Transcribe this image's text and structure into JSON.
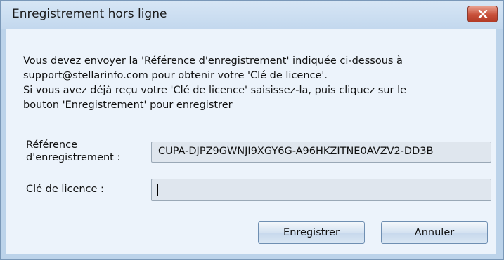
{
  "window": {
    "title": "Enregistrement hors ligne"
  },
  "message": {
    "lines": [
      "Vous devez envoyer la 'Référence d'enregistrement' indiquée ci-dessous à",
      "support@stellarinfo.com pour obtenir votre 'Clé de licence'.",
      "Si vous avez déjà reçu votre 'Clé de licence' saisissez-la, puis cliquez sur le",
      "bouton 'Enregistrement' pour enregistrer"
    ]
  },
  "form": {
    "reference_label_line1": "Référence",
    "reference_label_line2": "d'enregistrement :",
    "reference_value": "CUPA-DJPZ9GWNJI9XGY6G-A96HKZITNE0AVZV2-DD3B",
    "key_label": "Clé de licence :",
    "key_value": ""
  },
  "buttons": {
    "register_label": "Enregistrer",
    "cancel_label": "Annuler"
  },
  "colors": {
    "frame": "#bcd3ea",
    "content_bg": "#ecf3fb",
    "close_button": "#c8503a"
  },
  "icons": {
    "close": "close-icon"
  }
}
